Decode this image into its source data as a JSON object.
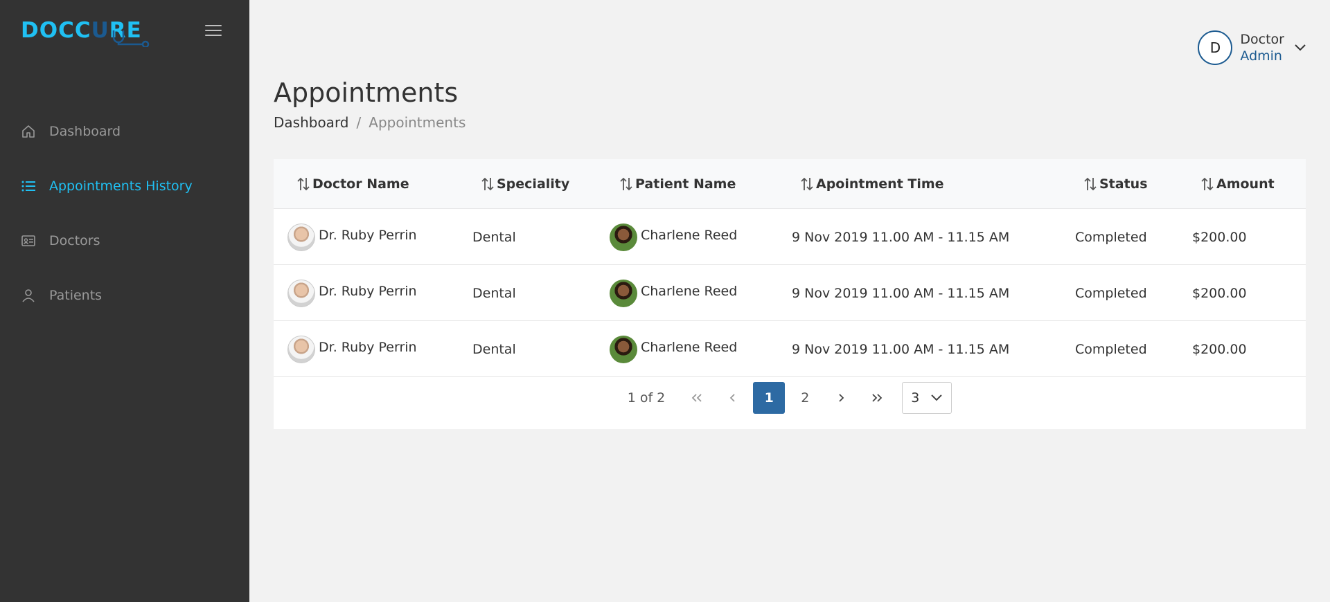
{
  "brand": {
    "logo_text_a": "DOCC",
    "logo_text_u": "U",
    "logo_text_b": "RE",
    "primary_color": "#20c0f3",
    "secondary_color": "#1b5a90"
  },
  "sidebar": {
    "items": [
      {
        "label": "Dashboard",
        "icon": "home-icon",
        "active": false
      },
      {
        "label": "Appointments History",
        "icon": "list-icon",
        "active": true
      },
      {
        "label": "Doctors",
        "icon": "id-card-icon",
        "active": false
      },
      {
        "label": "Patients",
        "icon": "user-icon",
        "active": false
      }
    ]
  },
  "user": {
    "initial": "D",
    "name": "Doctor",
    "role": "Admin"
  },
  "page": {
    "title": "Appointments"
  },
  "breadcrumb": {
    "home": "Dashboard",
    "separator": "/",
    "current": "Appointments"
  },
  "table": {
    "columns": [
      "Doctor Name",
      "Speciality",
      "Patient Name",
      "Apointment Time",
      "Status",
      "Amount"
    ],
    "rows": [
      {
        "doctor": "Dr. Ruby Perrin",
        "speciality": "Dental",
        "patient": "Charlene Reed",
        "time": "9 Nov 2019 11.00 AM - 11.15 AM",
        "status": "Completed",
        "amount": "$200.00"
      },
      {
        "doctor": "Dr. Ruby Perrin",
        "speciality": "Dental",
        "patient": "Charlene Reed",
        "time": "9 Nov 2019 11.00 AM - 11.15 AM",
        "status": "Completed",
        "amount": "$200.00"
      },
      {
        "doctor": "Dr. Ruby Perrin",
        "speciality": "Dental",
        "patient": "Charlene Reed",
        "time": "9 Nov 2019 11.00 AM - 11.15 AM",
        "status": "Completed",
        "amount": "$200.00"
      }
    ]
  },
  "pagination": {
    "info": "1 of 2",
    "first_icon": "chevron-double-left-icon",
    "prev_icon": "chevron-left-icon",
    "pages": [
      "1",
      "2"
    ],
    "current_page": "1",
    "next_icon": "chevron-right-icon",
    "last_icon": "chevron-double-right-icon",
    "page_size": "3"
  }
}
